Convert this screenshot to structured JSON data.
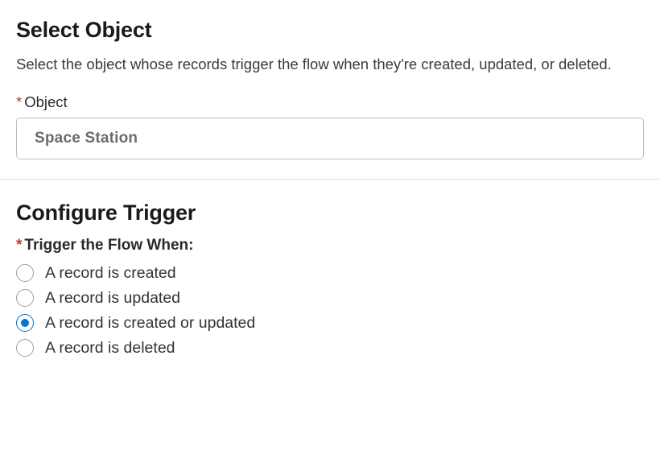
{
  "select_object": {
    "heading": "Select Object",
    "description": "Select the object whose records trigger the flow when they're created, updated, or deleted.",
    "field_label": "Object",
    "asterisk": "*",
    "object_value": "Space Station"
  },
  "configure_trigger": {
    "heading": "Configure Trigger",
    "asterisk": "*",
    "legend_label": "Trigger the Flow When:",
    "options": [
      {
        "label": "A record is created",
        "checked": false
      },
      {
        "label": "A record is updated",
        "checked": false
      },
      {
        "label": "A record is created or updated",
        "checked": true
      },
      {
        "label": "A record is deleted",
        "checked": false
      }
    ]
  }
}
